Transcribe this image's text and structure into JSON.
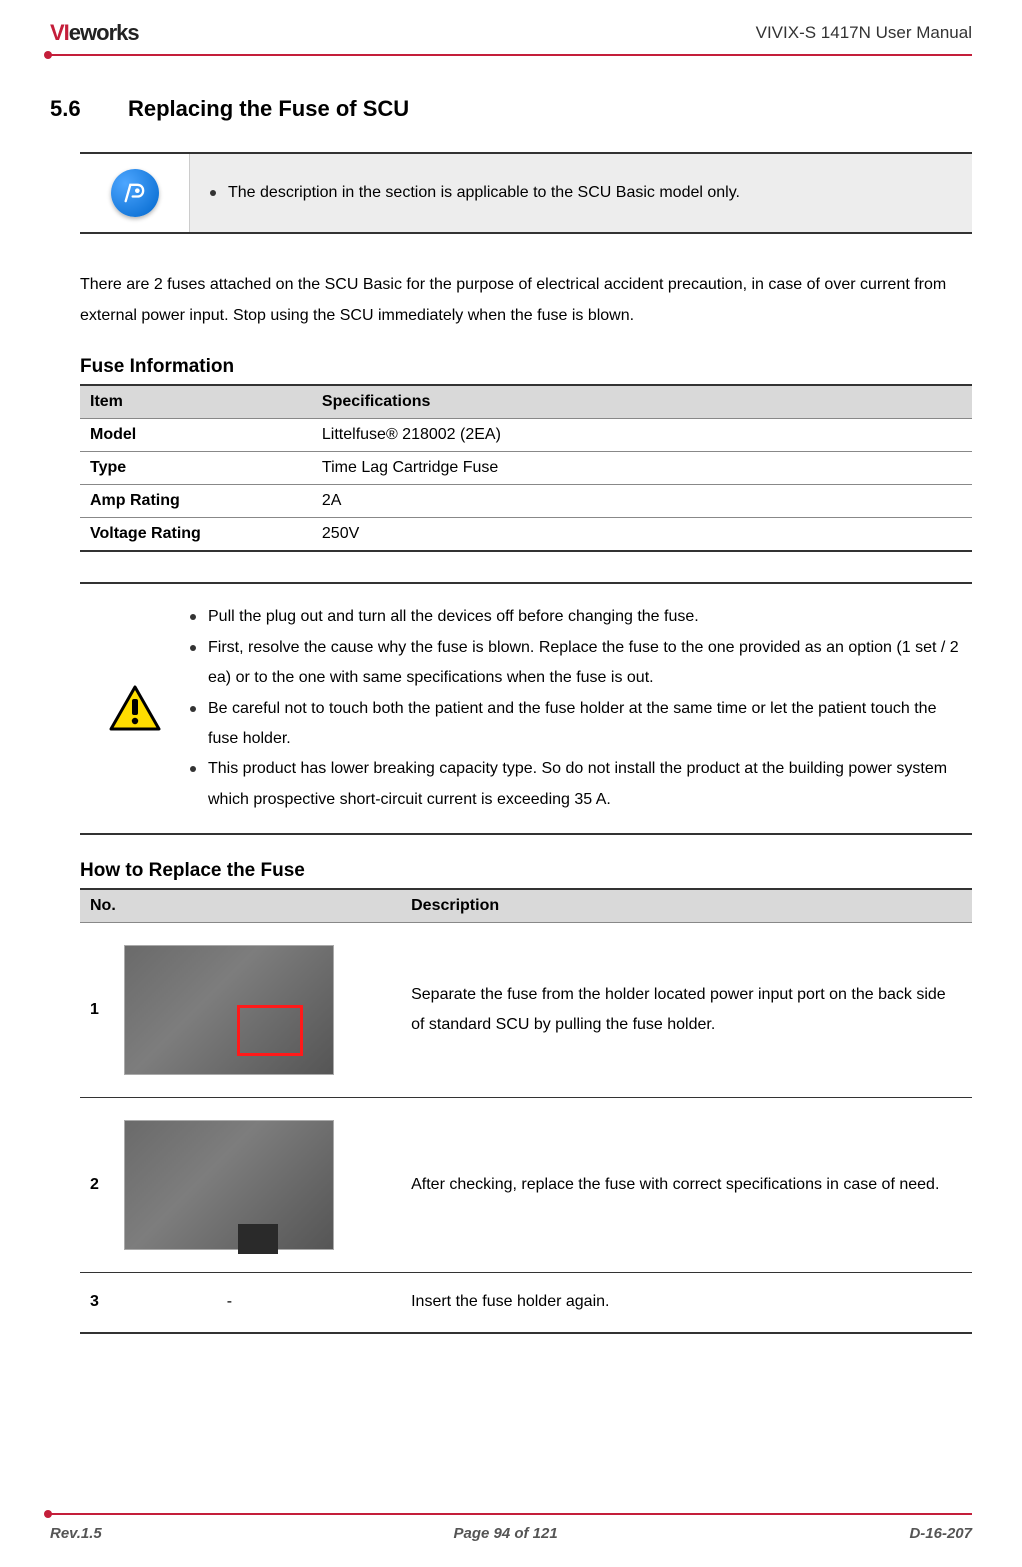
{
  "header": {
    "logo_v": "VI",
    "logo_rest": "eworks",
    "doc_title": "VIVIX-S 1417N User Manual"
  },
  "section": {
    "number": "5.6",
    "title": "Replacing the Fuse of SCU"
  },
  "note_box": {
    "item1": "The description in the section is applicable to the SCU Basic model only."
  },
  "intro_paragraph": "There are 2 fuses attached on the SCU Basic for the purpose of electrical accident precaution, in case of over current from external power input. Stop using the SCU immediately when the fuse is blown.",
  "fuse_info": {
    "heading": "Fuse Information",
    "col_item": "Item",
    "col_spec": "Specifications",
    "rows": [
      {
        "item": "Model",
        "spec": "Littelfuse® 218002 (2EA)"
      },
      {
        "item": "Type",
        "spec": "Time Lag Cartridge Fuse"
      },
      {
        "item": "Amp Rating",
        "spec": "2A"
      },
      {
        "item": "Voltage Rating",
        "spec": "250V"
      }
    ]
  },
  "warning_box": {
    "items": [
      "Pull the plug out and turn all the devices off before changing the fuse.",
      "First, resolve the cause why the fuse is blown. Replace the fuse to the one provided as an option (1 set / 2 ea) or to the one with same specifications when the fuse is out.",
      "Be careful not to touch both the patient and the fuse holder at the same time or let the patient touch the fuse holder.",
      "This product has lower breaking capacity type. So do not install the product at the building power system which prospective short-circuit current is exceeding 35 A."
    ]
  },
  "howto": {
    "heading": "How to Replace the Fuse",
    "col_no": "No.",
    "col_desc": "Description",
    "steps": [
      {
        "no": "1",
        "img": "photo",
        "desc": "Separate the fuse from the holder located power input port on the back side of standard SCU by pulling the fuse holder."
      },
      {
        "no": "2",
        "img": "photo",
        "desc": "After checking, replace the fuse with correct specifications in case of need."
      },
      {
        "no": "3",
        "img": "-",
        "desc": "Insert the fuse holder again."
      }
    ]
  },
  "footer": {
    "rev": "Rev.1.5",
    "page": "Page 94 of 121",
    "docnum": "D-16-207"
  }
}
